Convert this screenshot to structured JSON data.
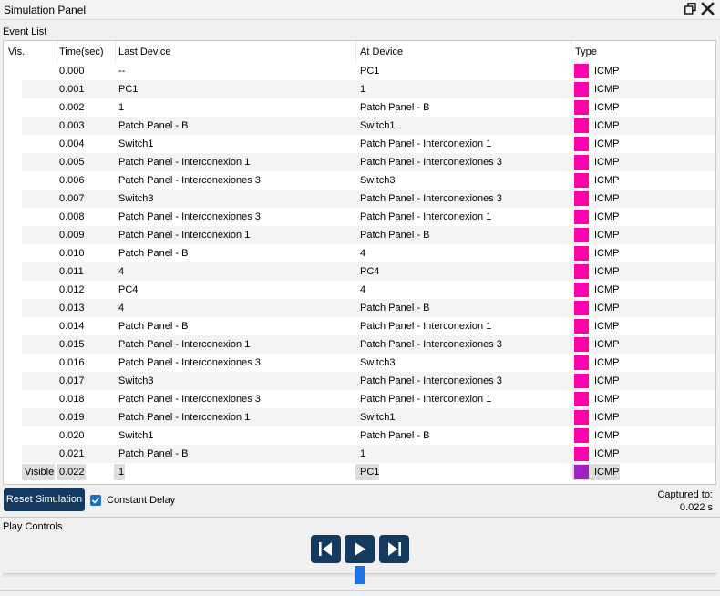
{
  "window": {
    "title": "Simulation Panel"
  },
  "event_list": {
    "label": "Event List",
    "columns": [
      "Vis.",
      "Time(sec)",
      "Last Device",
      "At Device",
      "Type"
    ],
    "rows": [
      {
        "vis": "",
        "time": "0.000",
        "last": "--",
        "at": "PC1",
        "type": "ICMP"
      },
      {
        "vis": "",
        "time": "0.001",
        "last": "PC1",
        "at": "1",
        "type": "ICMP"
      },
      {
        "vis": "",
        "time": "0.002",
        "last": "1",
        "at": "Patch Panel - B",
        "type": "ICMP"
      },
      {
        "vis": "",
        "time": "0.003",
        "last": "Patch Panel - B",
        "at": "Switch1",
        "type": "ICMP"
      },
      {
        "vis": "",
        "time": "0.004",
        "last": "Switch1",
        "at": "Patch Panel - Interconexion 1",
        "type": "ICMP"
      },
      {
        "vis": "",
        "time": "0.005",
        "last": "Patch Panel - Interconexion 1",
        "at": "Patch Panel - Interconexiones 3",
        "type": "ICMP"
      },
      {
        "vis": "",
        "time": "0.006",
        "last": "Patch Panel - Interconexiones 3",
        "at": "Switch3",
        "type": "ICMP"
      },
      {
        "vis": "",
        "time": "0.007",
        "last": "Switch3",
        "at": "Patch Panel - Interconexiones 3",
        "type": "ICMP"
      },
      {
        "vis": "",
        "time": "0.008",
        "last": "Patch Panel - Interconexiones 3",
        "at": "Patch Panel - Interconexion 1",
        "type": "ICMP"
      },
      {
        "vis": "",
        "time": "0.009",
        "last": "Patch Panel - Interconexion 1",
        "at": "Patch Panel - B",
        "type": "ICMP"
      },
      {
        "vis": "",
        "time": "0.010",
        "last": "Patch Panel - B",
        "at": "4",
        "type": "ICMP"
      },
      {
        "vis": "",
        "time": "0.011",
        "last": "4",
        "at": "PC4",
        "type": "ICMP"
      },
      {
        "vis": "",
        "time": "0.012",
        "last": "PC4",
        "at": "4",
        "type": "ICMP"
      },
      {
        "vis": "",
        "time": "0.013",
        "last": "4",
        "at": "Patch Panel - B",
        "type": "ICMP"
      },
      {
        "vis": "",
        "time": "0.014",
        "last": "Patch Panel - B",
        "at": "Patch Panel - Interconexion 1",
        "type": "ICMP"
      },
      {
        "vis": "",
        "time": "0.015",
        "last": "Patch Panel - Interconexion 1",
        "at": "Patch Panel - Interconexiones 3",
        "type": "ICMP"
      },
      {
        "vis": "",
        "time": "0.016",
        "last": "Patch Panel - Interconexiones 3",
        "at": "Switch3",
        "type": "ICMP"
      },
      {
        "vis": "",
        "time": "0.017",
        "last": "Switch3",
        "at": "Patch Panel - Interconexiones 3",
        "type": "ICMP"
      },
      {
        "vis": "",
        "time": "0.018",
        "last": "Patch Panel - Interconexiones 3",
        "at": "Patch Panel - Interconexion 1",
        "type": "ICMP"
      },
      {
        "vis": "",
        "time": "0.019",
        "last": "Patch Panel - Interconexion 1",
        "at": "Switch1",
        "type": "ICMP"
      },
      {
        "vis": "",
        "time": "0.020",
        "last": "Switch1",
        "at": "Patch Panel - B",
        "type": "ICMP"
      },
      {
        "vis": "",
        "time": "0.021",
        "last": "Patch Panel - B",
        "at": "1",
        "type": "ICMP"
      },
      {
        "vis": "Visible",
        "time": "0.022",
        "last": "1",
        "at": "PC1",
        "type": "ICMP",
        "selected": true
      }
    ]
  },
  "controls": {
    "reset_label": "Reset Simulation",
    "constant_delay_label": "Constant Delay",
    "constant_delay_checked": true,
    "captured_label": "Captured to:",
    "captured_value": "0.022 s"
  },
  "play_controls": {
    "label": "Play Controls",
    "buttons": [
      "back-icon",
      "play-icon",
      "forward-icon"
    ],
    "slider_value_fraction": 0.5
  },
  "colors": {
    "icmp": "#ff00aa",
    "icmp_selected": "#a020c0",
    "accent": "#153a5f",
    "checkbox": "#1f6fc6",
    "slider_thumb": "#1a73e8"
  }
}
